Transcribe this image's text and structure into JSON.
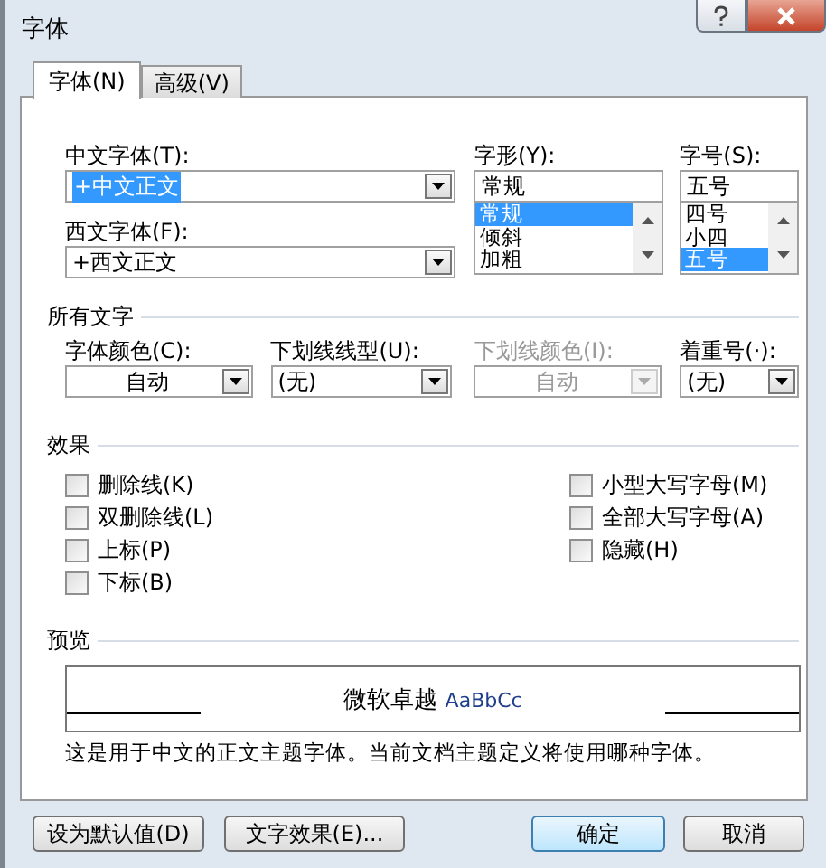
{
  "window": {
    "title": "字体"
  },
  "tabs": [
    {
      "label": "字体(N)",
      "selected": true
    },
    {
      "label": "高级(V)",
      "selected": false
    }
  ],
  "chinese_font": {
    "label": "中文字体(T):",
    "value": "+中文正文",
    "highlighted": true
  },
  "western_font": {
    "label": "西文字体(F):",
    "value": "+西文正文",
    "highlighted": false
  },
  "font_style": {
    "label": "字形(Y):",
    "value": "常规",
    "options": [
      {
        "label": "常规",
        "selected": true
      },
      {
        "label": "倾斜",
        "selected": false
      },
      {
        "label": "加粗",
        "selected": false
      }
    ]
  },
  "font_size": {
    "label": "字号(S):",
    "value": "五号",
    "options": [
      {
        "label": "四号",
        "selected": false
      },
      {
        "label": "小四",
        "selected": false
      },
      {
        "label": "五号",
        "selected": true
      }
    ]
  },
  "all_text": {
    "heading": "所有文字",
    "combos": [
      {
        "label": "字体颜色(C):",
        "value": "自动",
        "kind": "color",
        "disabled": false
      },
      {
        "label": "下划线线型(U):",
        "value": "(无)",
        "kind": "text",
        "disabled": false
      },
      {
        "label": "下划线颜色(I):",
        "value": "自动",
        "kind": "color",
        "disabled": true
      },
      {
        "label": "着重号(·):",
        "value": "(无)",
        "kind": "text",
        "disabled": false
      }
    ]
  },
  "effects": {
    "heading": "效果",
    "left": [
      {
        "label": "删除线(K)",
        "checked": false
      },
      {
        "label": "双删除线(L)",
        "checked": false
      },
      {
        "label": "上标(P)",
        "checked": false
      },
      {
        "label": "下标(B)",
        "checked": false
      }
    ],
    "right": [
      {
        "label": "小型大写字母(M)",
        "checked": false
      },
      {
        "label": "全部大写字母(A)",
        "checked": false
      },
      {
        "label": "隐藏(H)",
        "checked": false
      }
    ]
  },
  "preview": {
    "heading": "预览",
    "sample_cjk": "微软卓越",
    "sample_latin": "AaBbCc",
    "description": "这是用于中文的正文主题字体。当前文档主题定义将使用哪种字体。"
  },
  "buttons": [
    {
      "label": "设为默认值(D)",
      "default": false
    },
    {
      "label": "文字效果(E)...",
      "default": false
    },
    {
      "label": "确定",
      "default": true
    },
    {
      "label": "取消",
      "default": false
    }
  ]
}
